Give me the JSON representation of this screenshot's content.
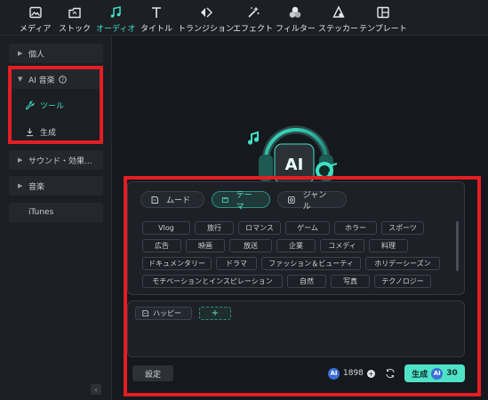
{
  "toolbar": {
    "items": [
      {
        "label": "メディア",
        "icon": "media-icon"
      },
      {
        "label": "ストック",
        "icon": "stock-icon"
      },
      {
        "label": "オーディオ",
        "icon": "music-note-icon",
        "active": true
      },
      {
        "label": "タイトル",
        "icon": "title-t-icon"
      },
      {
        "label": "トランジション",
        "icon": "transition-icon"
      },
      {
        "label": "エフェクト",
        "icon": "effect-sparkle-icon"
      },
      {
        "label": "フィルター",
        "icon": "filter-circles-icon"
      },
      {
        "label": "ステッカー",
        "icon": "sticker-icon"
      },
      {
        "label": "テンプレート",
        "icon": "template-icon"
      }
    ]
  },
  "sidebar": {
    "personal": "個人",
    "ai_music": "AI 音楽",
    "tool": "ツール",
    "generate": "生成",
    "sound_effects": "サウンド・効果...",
    "music": "音楽",
    "itunes": "iTunes"
  },
  "tabs": {
    "mood": "ムード",
    "theme": "テーマ",
    "genre": "ジャンル"
  },
  "tags": {
    "row1": [
      "Vlog",
      "旅行",
      "ロマンス",
      "ゲーム",
      "ホラー",
      "スポーツ"
    ],
    "row2": [
      "広告",
      "映画",
      "放送",
      "企業",
      "コメディ",
      "料理"
    ],
    "row3": [
      "ドキュメンタリー",
      "ドラマ",
      "ファッション＆ビューティ",
      "ホリデーシーズン"
    ],
    "row4": [
      "モチベーションとインスピレーション",
      "自然",
      "写真",
      "テクノロジー"
    ]
  },
  "prompt": {
    "selected_tag": "ハッピー",
    "add": "+"
  },
  "footer": {
    "settings": "設定",
    "credits": "1898",
    "ai_badge": "AI",
    "generate": "生成",
    "generate_cost": "30"
  },
  "colors": {
    "accent": "#3fe0c6",
    "highlight_box": "#e31e24",
    "generate_button": "#4ee2c7"
  }
}
